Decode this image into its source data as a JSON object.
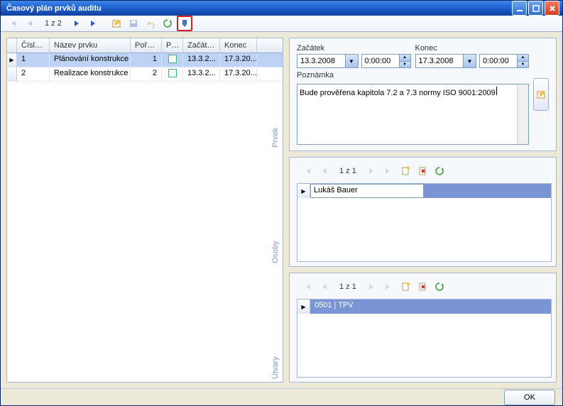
{
  "window": {
    "title": "Časový plán prvků auditu"
  },
  "toolbar": {
    "position": "1 z 2"
  },
  "grid": {
    "headers": {
      "cislo": "Číslo ...",
      "nazev": "Název prvku",
      "pora": "Pořa...",
      "pr": "Pr...",
      "zacatek": "Začátek",
      "konec": "Konec"
    },
    "rows": [
      {
        "cislo": "1",
        "nazev": "Plánování konstrukce",
        "pora": "1",
        "zacatek": "13.3.2...",
        "konec": "17.3.20..."
      },
      {
        "cislo": "2",
        "nazev": "Realizace konstrukce",
        "pora": "2",
        "zacatek": "13.3.2...",
        "konec": "17.3.20..."
      }
    ]
  },
  "prvek": {
    "label": "Prvek",
    "zacatek_label": "Začátek",
    "konec_label": "Konec",
    "poznamka_label": "Poznámka",
    "zacatek_date": "13.3.2008",
    "zacatek_time": "0:00:00",
    "konec_date": "17.3.2008",
    "konec_time": "0:00:00",
    "poznamka": "Bude prověřena kapitola 7.2 a 7.3 normy ISO 9001:2009"
  },
  "osoby": {
    "label": "Osoby",
    "position": "1 z 1",
    "row": "Lukáš  Bauer"
  },
  "utvary": {
    "label": "Útvary",
    "position": "1 z 1",
    "row": "0501 | TPV"
  },
  "footer": {
    "ok": "OK"
  },
  "colors": {
    "accent": "#3a88e8",
    "select": "#bcd3f5",
    "panel": "#f6f8fc",
    "border": "#a6b8d8"
  }
}
